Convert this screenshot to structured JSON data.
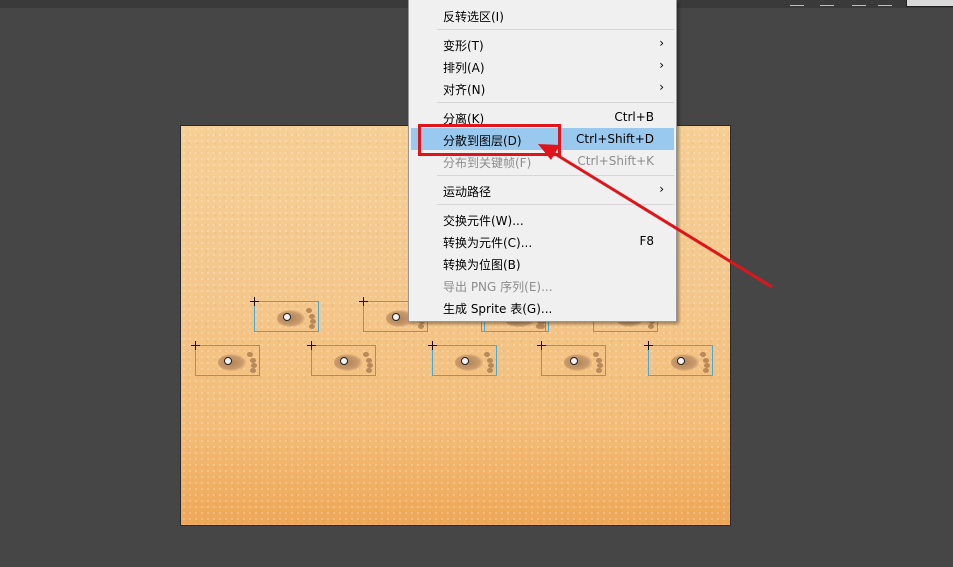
{
  "menu": {
    "items": [
      {
        "label": "反转选区(I)",
        "shortcut": "",
        "submenu": false,
        "disabled": false
      },
      {
        "label": "变形(T)",
        "shortcut": "",
        "submenu": true,
        "disabled": false
      },
      {
        "label": "排列(A)",
        "shortcut": "",
        "submenu": true,
        "disabled": false
      },
      {
        "label": "对齐(N)",
        "shortcut": "",
        "submenu": true,
        "disabled": false
      },
      {
        "label": "分离(K)",
        "shortcut": "Ctrl+B",
        "submenu": false,
        "disabled": false
      },
      {
        "label": "分散到图层(D)",
        "shortcut": "Ctrl+Shift+D",
        "submenu": false,
        "disabled": false,
        "highlighted": true
      },
      {
        "label": "分布到关键帧(F)",
        "shortcut": "Ctrl+Shift+K",
        "submenu": false,
        "disabled": true
      },
      {
        "label": "运动路径",
        "shortcut": "",
        "submenu": true,
        "disabled": false
      },
      {
        "label": "交换元件(W)...",
        "shortcut": "",
        "submenu": false,
        "disabled": false
      },
      {
        "label": "转换为元件(C)...",
        "shortcut": "F8",
        "submenu": false,
        "disabled": false
      },
      {
        "label": "转换为位图(B)",
        "shortcut": "",
        "submenu": false,
        "disabled": false
      },
      {
        "label": "导出 PNG 序列(E)...",
        "shortcut": "",
        "submenu": false,
        "disabled": true
      },
      {
        "label": "生成 Sprite 表(G)...",
        "shortcut": "",
        "submenu": false,
        "disabled": false
      }
    ],
    "submenu_arrow": "›"
  },
  "colors": {
    "highlight": "#99c9ef",
    "annotation_red": "#e0141b",
    "selection_box": "#47a9d7"
  },
  "stage": {
    "footprint_count": 10
  }
}
